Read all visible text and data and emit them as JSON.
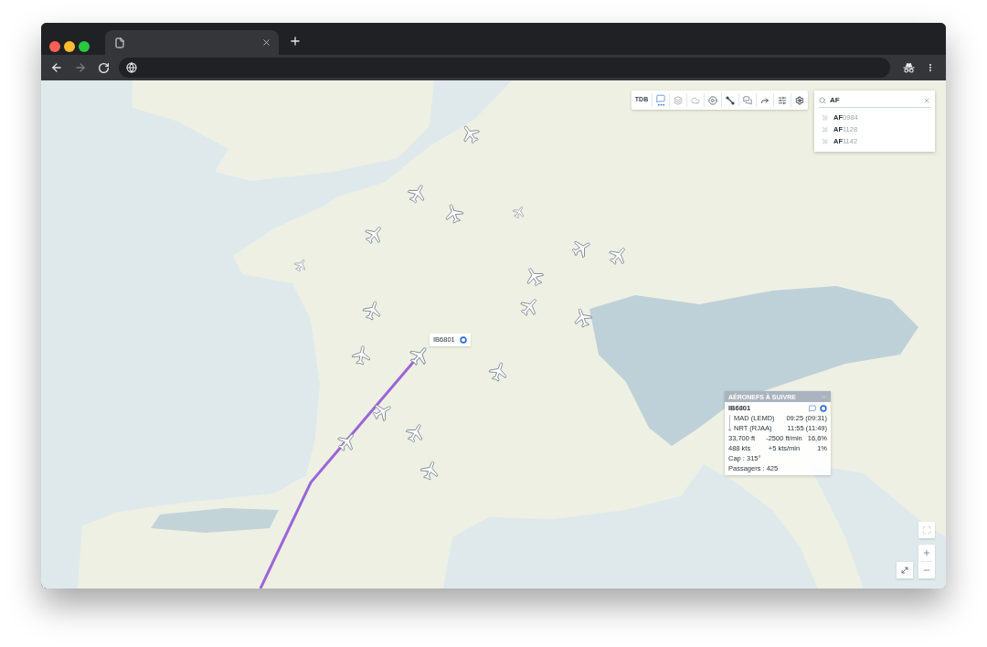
{
  "browser": {
    "back": {
      "disabled": false
    },
    "forward": {
      "disabled": true
    }
  },
  "map": {
    "toolbar": {
      "label": "TDB",
      "tools": [
        {
          "selected": true
        },
        {
          "selected": false
        },
        {
          "selected": false
        },
        {
          "selected": false
        },
        {
          "selected": false
        },
        {
          "selected": false
        },
        {
          "selected": false
        },
        {
          "selected": false
        },
        {
          "selected": false
        }
      ]
    },
    "search": {
      "value": "AF",
      "results": [
        "**AF**0984",
        "**AF**1128",
        "**AF**1142"
      ]
    },
    "flight_label": {
      "callsign": "IB6801"
    },
    "tracking_panel": {
      "title": "AÉRONEFS À SUIVRE",
      "flights": [
        {
          "callsign": "IB6801",
          "origin": "MAD (LEMD)",
          "departure_time": "09:25 (09:31)",
          "destination": "NRT (RJAA)",
          "arrival_time": "11:55 (11:49)",
          "altitude_row": [
            "33,700 ft",
            "-2500 ft/min",
            "16,6%"
          ],
          "speed_row": [
            "488 kts",
            "+5 kts/min",
            "1%"
          ],
          "heading": "Cap : 315°",
          "passengers": "Passagers : 425"
        }
      ]
    }
  }
}
